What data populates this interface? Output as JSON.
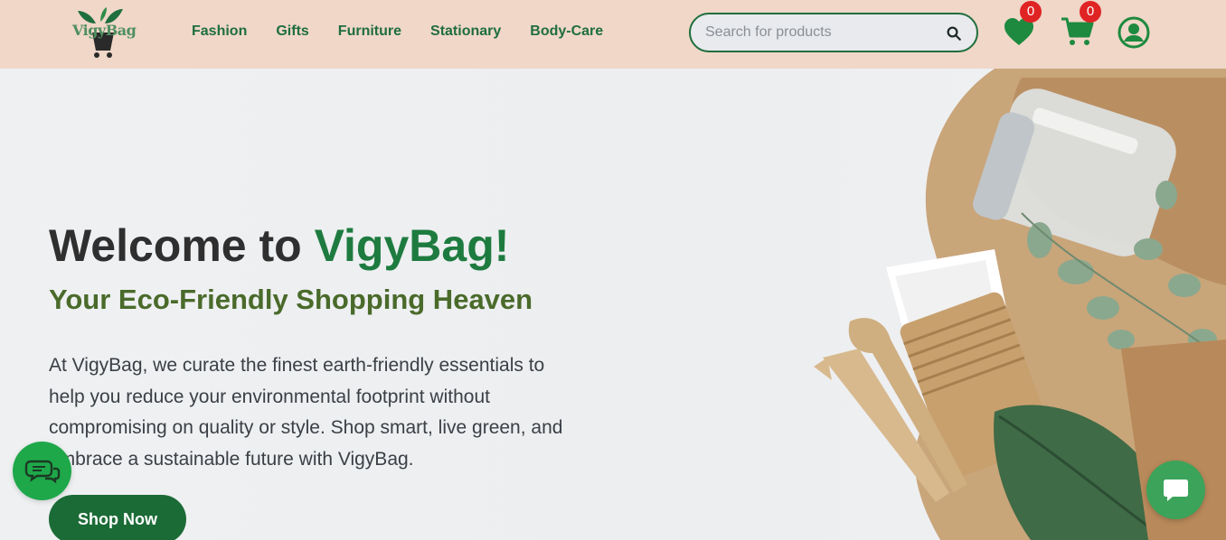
{
  "header": {
    "logo_text": "VigyBag",
    "nav": [
      {
        "label": "Fashion"
      },
      {
        "label": "Gifts"
      },
      {
        "label": "Furniture"
      },
      {
        "label": "Stationary"
      },
      {
        "label": "Body-Care"
      }
    ],
    "search": {
      "placeholder": "Search for products",
      "value": ""
    },
    "wishlist_count": "0",
    "cart_count": "0",
    "icons": [
      "heart-icon",
      "cart-icon",
      "user-icon",
      "search-icon"
    ]
  },
  "hero": {
    "title_prefix": "Welcome to ",
    "title_brand": "VigyBag!",
    "subtitle": "Your Eco-Friendly Shopping Heaven",
    "description": "At VigyBag, we curate the finest earth-friendly essentials to help you reduce your environmental footprint without compromising on quality or style. Shop smart, live green, and embrace a sustainable future with VigyBag.",
    "cta": "Shop Now"
  },
  "colors": {
    "header_bg": "#f0d7c8",
    "brand_green": "#1e7b3f",
    "subtitle_green": "#4a6a2a",
    "badge_red": "#e02424",
    "chat_green": "#1ea84a"
  }
}
